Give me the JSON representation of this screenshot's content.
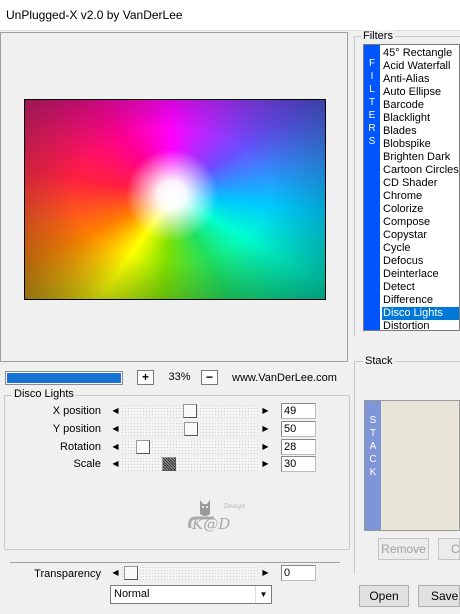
{
  "window": {
    "title": "UnPlugged-X v2.0 by VanDerLee"
  },
  "zoom": {
    "plus": "+",
    "minus": "−",
    "value": "33%",
    "progress": 1.0,
    "website": "www.VanDerLee.com"
  },
  "params": {
    "group_label": "Disco Lights",
    "items": [
      {
        "label": "X position",
        "value": "49"
      },
      {
        "label": "Y position",
        "value": "50"
      },
      {
        "label": "Rotation",
        "value": "28"
      },
      {
        "label": "Scale",
        "value": "30"
      }
    ]
  },
  "transparency": {
    "label": "Transparency",
    "value": "0"
  },
  "blend_mode": {
    "selected": "Normal"
  },
  "filters": {
    "group_label": "Filters",
    "strip_letters": [
      "F",
      "I",
      "L",
      "T",
      "E",
      "R",
      "S"
    ],
    "items": [
      "45° Rectangle",
      "Acid Waterfall",
      "Anti-Alias",
      "Auto Ellipse",
      "Barcode",
      "Blacklight",
      "Blades",
      "Blobspike",
      "Brighten Dark",
      "Cartoon Circles",
      "CD Shader",
      "Chrome",
      "Colorize",
      "Compose",
      "Copystar",
      "Cycle",
      "Defocus",
      "Deinterlace",
      "Detect",
      "Difference",
      "Disco Lights",
      "Distortion"
    ],
    "selected": "Disco Lights"
  },
  "stack": {
    "group_label": "Stack",
    "strip_letters": [
      "S",
      "T",
      "A",
      "C",
      "K"
    ],
    "remove_label": "Remove",
    "copy_label": "C"
  },
  "buttons": {
    "open": "Open",
    "save": "Save"
  },
  "icons": {
    "arrow_left": "◀",
    "arrow_right": "▶",
    "dropdown": "▼"
  },
  "colors": {
    "accent": "#0078d7",
    "progress": "#1672d6",
    "strip": "#0055ff"
  }
}
